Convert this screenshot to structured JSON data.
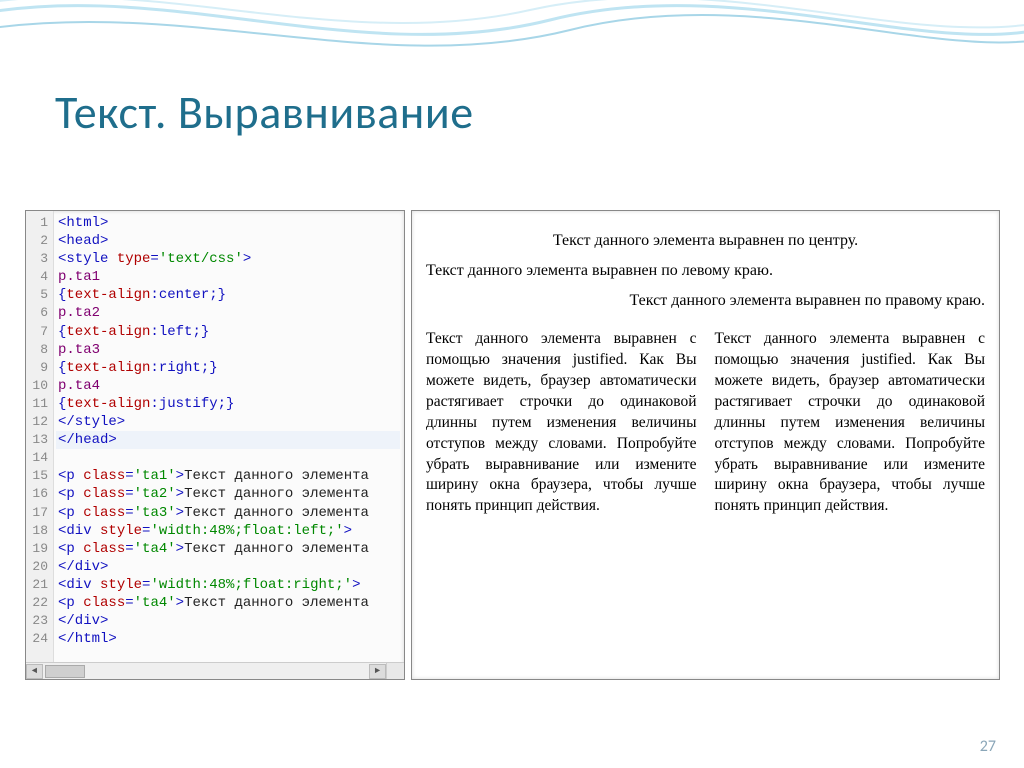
{
  "title": "Текст. Выравнивание",
  "page_number": "27",
  "code": {
    "lines": [
      [
        {
          "c": "tok-tag",
          "t": "<html>"
        }
      ],
      [
        {
          "c": "tok-tag",
          "t": "<head>"
        }
      ],
      [
        {
          "c": "tok-tag",
          "t": "<style "
        },
        {
          "c": "tok-attr",
          "t": "type"
        },
        {
          "c": "tok-tag",
          "t": "="
        },
        {
          "c": "tok-str",
          "t": "'text/css'"
        },
        {
          "c": "tok-tag",
          "t": ">"
        }
      ],
      [
        {
          "c": "tok-sel",
          "t": "p.ta1"
        }
      ],
      [
        {
          "c": "tok-tag",
          "t": "{"
        },
        {
          "c": "tok-prop",
          "t": "text-align"
        },
        {
          "c": "tok-tag",
          "t": ":"
        },
        {
          "c": "tok-val",
          "t": "center"
        },
        {
          "c": "tok-tag",
          "t": ";}"
        }
      ],
      [
        {
          "c": "tok-sel",
          "t": "p.ta2"
        }
      ],
      [
        {
          "c": "tok-tag",
          "t": "{"
        },
        {
          "c": "tok-prop",
          "t": "text-align"
        },
        {
          "c": "tok-tag",
          "t": ":"
        },
        {
          "c": "tok-val",
          "t": "left"
        },
        {
          "c": "tok-tag",
          "t": ";}"
        }
      ],
      [
        {
          "c": "tok-sel",
          "t": "p.ta3"
        }
      ],
      [
        {
          "c": "tok-tag",
          "t": "{"
        },
        {
          "c": "tok-prop",
          "t": "text-align"
        },
        {
          "c": "tok-tag",
          "t": ":"
        },
        {
          "c": "tok-val",
          "t": "right"
        },
        {
          "c": "tok-tag",
          "t": ";}"
        }
      ],
      [
        {
          "c": "tok-sel",
          "t": "p.ta4"
        }
      ],
      [
        {
          "c": "tok-tag",
          "t": "{"
        },
        {
          "c": "tok-prop",
          "t": "text-align"
        },
        {
          "c": "tok-tag",
          "t": ":"
        },
        {
          "c": "tok-val",
          "t": "justify"
        },
        {
          "c": "tok-tag",
          "t": ";}"
        }
      ],
      [
        {
          "c": "tok-tag",
          "t": "</style>"
        }
      ],
      [
        {
          "c": "tok-tag",
          "t": "</head>"
        }
      ],
      [
        {
          "c": "tok-tag",
          "t": "<p "
        },
        {
          "c": "tok-attr",
          "t": "class"
        },
        {
          "c": "tok-tag",
          "t": "="
        },
        {
          "c": "tok-str",
          "t": "'ta1'"
        },
        {
          "c": "tok-tag",
          "t": ">"
        },
        {
          "c": "tok-txt",
          "t": "Текст данного элемента"
        }
      ],
      [
        {
          "c": "tok-tag",
          "t": "<p "
        },
        {
          "c": "tok-attr",
          "t": "class"
        },
        {
          "c": "tok-tag",
          "t": "="
        },
        {
          "c": "tok-str",
          "t": "'ta2'"
        },
        {
          "c": "tok-tag",
          "t": ">"
        },
        {
          "c": "tok-txt",
          "t": "Текст данного элемента"
        }
      ],
      [
        {
          "c": "tok-tag",
          "t": "<p "
        },
        {
          "c": "tok-attr",
          "t": "class"
        },
        {
          "c": "tok-tag",
          "t": "="
        },
        {
          "c": "tok-str",
          "t": "'ta3'"
        },
        {
          "c": "tok-tag",
          "t": ">"
        },
        {
          "c": "tok-txt",
          "t": "Текст данного элемента"
        }
      ],
      [
        {
          "c": "tok-tag",
          "t": "<div "
        },
        {
          "c": "tok-attr",
          "t": "style"
        },
        {
          "c": "tok-tag",
          "t": "="
        },
        {
          "c": "tok-str",
          "t": "'width:48%;float:left;'"
        },
        {
          "c": "tok-tag",
          "t": ">"
        }
      ],
      [
        {
          "c": "tok-tag",
          "t": "<p "
        },
        {
          "c": "tok-attr",
          "t": "class"
        },
        {
          "c": "tok-tag",
          "t": "="
        },
        {
          "c": "tok-str",
          "t": "'ta4'"
        },
        {
          "c": "tok-tag",
          "t": ">"
        },
        {
          "c": "tok-txt",
          "t": "Текст данного элемента"
        }
      ],
      [
        {
          "c": "tok-tag",
          "t": "</div>"
        }
      ],
      [
        {
          "c": "tok-tag",
          "t": "<div "
        },
        {
          "c": "tok-attr",
          "t": "style"
        },
        {
          "c": "tok-tag",
          "t": "="
        },
        {
          "c": "tok-str",
          "t": "'width:48%;float:right;'"
        },
        {
          "c": "tok-tag",
          "t": ">"
        }
      ],
      [
        {
          "c": "tok-tag",
          "t": "<p "
        },
        {
          "c": "tok-attr",
          "t": "class"
        },
        {
          "c": "tok-tag",
          "t": "="
        },
        {
          "c": "tok-str",
          "t": "'ta4'"
        },
        {
          "c": "tok-tag",
          "t": ">"
        },
        {
          "c": "tok-txt",
          "t": "Текст данного элемента"
        }
      ],
      [
        {
          "c": "tok-tag",
          "t": "</div>"
        }
      ],
      [
        {
          "c": "tok-tag",
          "t": "</html>"
        }
      ],
      [
        {
          "c": "tok-txt",
          "t": ""
        }
      ]
    ],
    "highlight_line": 13
  },
  "preview": {
    "p_center": "Текст данного элемента выравнен по центру.",
    "p_left": "Текст данного элемента выравнен по левому краю.",
    "p_right": "Текст данного элемента выравнен по правому краю.",
    "p_justify": "Текст данного элемента выравнен с помощью значения justified. Как Вы можете видеть, браузер автоматически растягивает строчки до одинаковой длинны путем изменения величины отступов между словами. Попробуйте убрать выравнивание или измените ширину окна браузера, чтобы лучше понять принцип действия."
  }
}
